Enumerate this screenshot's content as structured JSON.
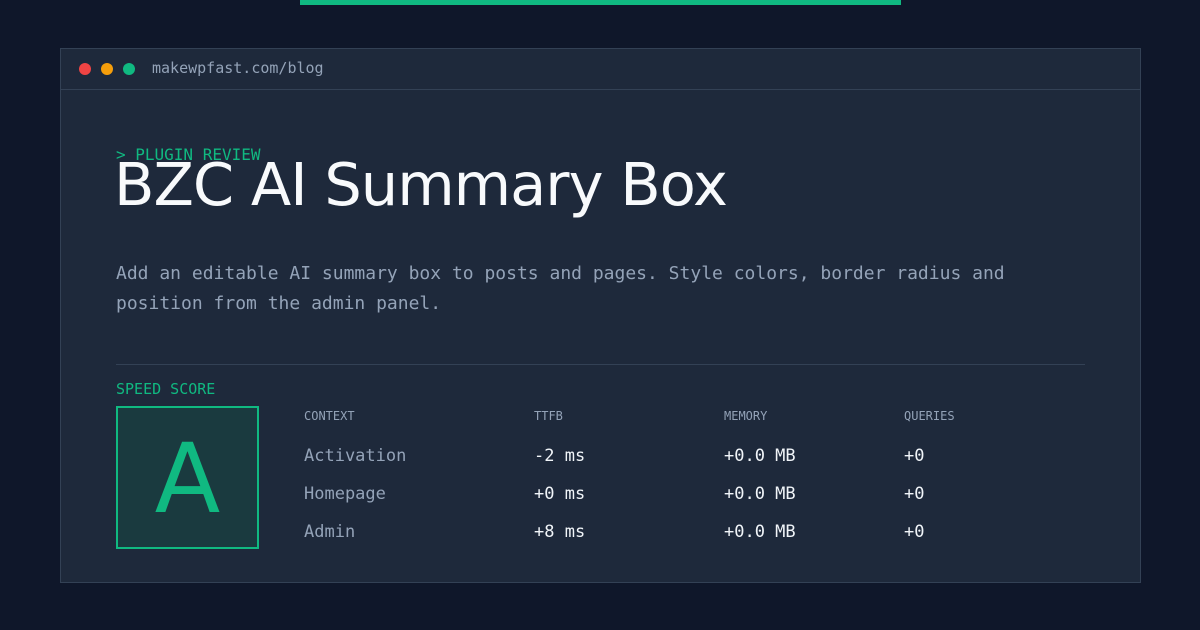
{
  "browser": {
    "url": "makewpfast.com/blog"
  },
  "post": {
    "eyebrow": "> PLUGIN REVIEW",
    "title": "BZC AI Summary Box",
    "description": "Add an editable AI summary box to posts and pages. Style colors, border radius and position from the admin panel."
  },
  "speed": {
    "label": "SPEED SCORE",
    "grade": "A",
    "columns": [
      "CONTEXT",
      "TTFB",
      "MEMORY",
      "QUERIES"
    ],
    "rows": [
      {
        "context": "Activation",
        "ttfb": "-2 ms",
        "memory": "+0.0 MB",
        "queries": "+0"
      },
      {
        "context": "Homepage",
        "ttfb": "+0 ms",
        "memory": "+0.0 MB",
        "queries": "+0"
      },
      {
        "context": "Admin",
        "ttfb": "+8 ms",
        "memory": "+0.0 MB",
        "queries": "+0"
      }
    ]
  },
  "colors": {
    "background": "#0f172a",
    "panel": "#1e293b",
    "accent": "#10b981",
    "muted_text": "#94a3b8",
    "title_text": "#f8fafc"
  }
}
